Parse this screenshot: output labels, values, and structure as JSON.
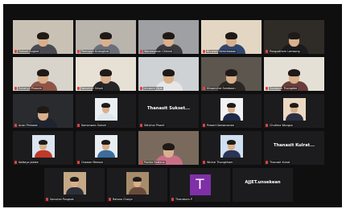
{
  "meeting": {
    "rows": [
      {
        "tiles": [
          {
            "name": "Trainee Angket",
            "kind": "video",
            "bg": "#c9c2b4",
            "body": "#4a4a52"
          },
          {
            "name": "Peerapan Kriangkrai",
            "kind": "video",
            "bg": "#b9b5ad",
            "body": "#6b6f77"
          },
          {
            "name": "Wanassanan Chinnoi",
            "kind": "video",
            "bg": "#9ea0a4",
            "body": "#3a3a3e"
          },
          {
            "name": "Bhuvsay Kemchawan",
            "kind": "video",
            "bg": "#e3d7c3",
            "body": "#31456d"
          },
          {
            "name": "Pongsathorn Lamsong",
            "kind": "video",
            "bg": "#2f2c28",
            "body": "#1b1b1e",
            "active": true
          }
        ]
      },
      {
        "tiles": [
          {
            "name": "Sukanya Phasom",
            "kind": "video",
            "bg": "#d8d4cc",
            "body": "#8e5546"
          },
          {
            "name": "Narumon Srisuk",
            "kind": "video",
            "bg": "#e7e1d5",
            "body": "#252527"
          },
          {
            "name": "Anusorn Jitjak",
            "kind": "video",
            "bg": "#cfd2d4",
            "body": "#e7e7e7"
          },
          {
            "name": "Khwanchai Somboon",
            "kind": "video",
            "bg": "#5d564f",
            "body": "#2b2623"
          },
          {
            "name": "Supaporn Thongdee",
            "kind": "video",
            "bg": "#e5e0d6",
            "body": "#6a3d3a"
          }
        ]
      },
      {
        "tiles": [
          {
            "name": "Anan Pinkaew",
            "kind": "video",
            "bg": "#2a2b2e",
            "body": "#1f2330"
          },
          {
            "name": "Kamonwan Suksiri",
            "kind": "small-pic",
            "bg": "#1c1c1e",
            "pic": "#eaf0f4",
            "body": "#dfe6ec"
          },
          {
            "name": "Sittichai Phanit",
            "kind": "name-only",
            "big": "Thanasit Sukset..."
          },
          {
            "name": "Prasert Kaewmanee",
            "kind": "small-pic",
            "bg": "#1c1c1e",
            "pic": "#f2f2f2",
            "body": "#1d2a4a"
          },
          {
            "name": "Chutima Wongsa",
            "kind": "small-pic",
            "bg": "#1c1c1e",
            "pic": "#ecd9c4",
            "body": "#2a2e44"
          }
        ]
      },
      {
        "tiles": [
          {
            "name": "Nattaya Jaidee",
            "kind": "small-pic",
            "bg": "#1c1c1e",
            "pic": "#dbe4ef",
            "body": "#c0392b"
          },
          {
            "name": "Orawan Meesuk",
            "kind": "small-pic",
            "bg": "#1c1c1e",
            "pic": "#e9eef3",
            "body": "#3b6e9e"
          },
          {
            "name": "Panida Rattana",
            "kind": "video",
            "bg": "#7a6a5e",
            "body": "#c86f87"
          },
          {
            "name": "Wichai Thongkham",
            "kind": "small-pic",
            "bg": "#1c1c1e",
            "pic": "#cfe0f0",
            "body": "#2b3553"
          },
          {
            "name": "Thanasit Kulrat",
            "kind": "name-only",
            "big": "Thanasit Kulrat..."
          }
        ]
      },
      {
        "offset": true,
        "tiles": [
          {
            "name": "Somchai Pongsak",
            "kind": "small-pic",
            "bg": "#1c1c1e",
            "pic": "#c5a886",
            "body": "#2c2f3a"
          },
          {
            "name": "Ratana Chaiyo",
            "kind": "small-pic",
            "bg": "#1c1c1e",
            "pic": "#a88c6a",
            "body": "#6a4a3a"
          },
          {
            "name": "Thanakorn P.",
            "kind": "avatar",
            "letter": "T",
            "color": "#7f2fa8"
          },
          {
            "name": "",
            "kind": "name-only",
            "big": "AJJET.unsekean"
          }
        ]
      }
    ]
  }
}
